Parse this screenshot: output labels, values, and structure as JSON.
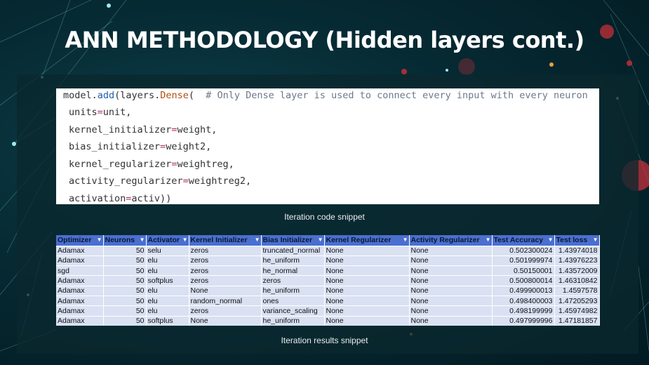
{
  "slide": {
    "title": "ANN METHODOLOGY (Hidden layers cont.)"
  },
  "code": {
    "line0_prefix": "model.",
    "line0_fn": "add",
    "line0_mid": "(layers.",
    "line0_cls": "Dense",
    "line0_paren": "(",
    "line0_comment": "  # Only Dense layer is used to connect every input with every neuron",
    "lines": [
      {
        "key": "units",
        "value": "unit,"
      },
      {
        "key": "kernel_initializer",
        "value": "weight,"
      },
      {
        "key": "bias_initializer",
        "value": "weight2,"
      },
      {
        "key": "kernel_regularizer",
        "value": "weightreg,"
      },
      {
        "key": "activity_regularizer",
        "value": "weightreg2,"
      },
      {
        "key": "activation",
        "value": "activ))"
      }
    ],
    "operator": "="
  },
  "captions": {
    "code": "Iteration code snippet",
    "results": "Iteration results snippet"
  },
  "table": {
    "headers": [
      "Optimizer",
      "Neurons",
      "Activator",
      "Kernel Initializer",
      "Bias Initializer",
      "Kernel Regularizer",
      "Activity Regularizer",
      "Test Accuracy",
      "Test loss"
    ],
    "rows": [
      [
        "Adamax",
        "50",
        "selu",
        "zeros",
        "truncated_normal",
        "None",
        "None",
        "0.502300024",
        "1.43974018"
      ],
      [
        "Adamax",
        "50",
        "elu",
        "zeros",
        "he_uniform",
        "None",
        "None",
        "0.501999974",
        "1.43976223"
      ],
      [
        "sgd",
        "50",
        "elu",
        "zeros",
        "he_normal",
        "None",
        "None",
        "0.50150001",
        "1.43572009"
      ],
      [
        "Adamax",
        "50",
        "softplus",
        "zeros",
        "zeros",
        "None",
        "None",
        "0.500800014",
        "1.46310842"
      ],
      [
        "Adamax",
        "50",
        "elu",
        "None",
        "he_uniform",
        "None",
        "None",
        "0.499900013",
        "1.4597578"
      ],
      [
        "Adamax",
        "50",
        "elu",
        "random_normal",
        "ones",
        "None",
        "None",
        "0.498400003",
        "1.47205293"
      ],
      [
        "Adamax",
        "50",
        "elu",
        "zeros",
        "variance_scaling",
        "None",
        "None",
        "0.498199999",
        "1.45974982"
      ],
      [
        "Adamax",
        "50",
        "softplus",
        "None",
        "he_uniform",
        "None",
        "None",
        "0.497999996",
        "1.47181857"
      ]
    ],
    "filter_icon": "filter-dropdown-icon"
  },
  "colors": {
    "header_bg": "#4a6fd0",
    "row_bg": "#d9e1f2",
    "background": "#062a33",
    "accent_red": "#c0202a"
  }
}
